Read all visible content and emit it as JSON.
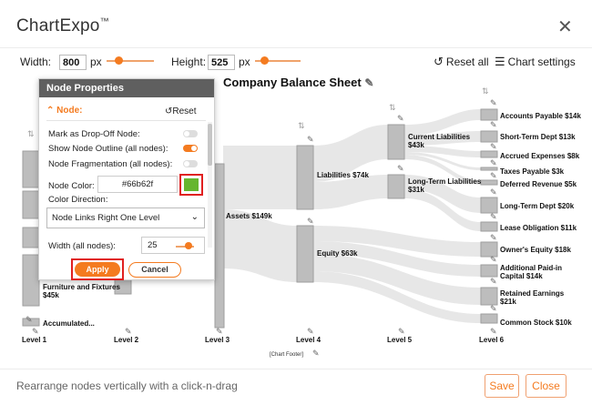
{
  "app": {
    "title": "ChartExpo",
    "trademark": "™"
  },
  "controls": {
    "width_label": "Width:",
    "width_value": "800",
    "width_unit": "px",
    "width_fraction": 0.25,
    "height_label": "Height:",
    "height_value": "525",
    "height_unit": "px",
    "height_fraction": 0.2,
    "reset_all": "Reset all",
    "chart_settings": "Chart settings"
  },
  "chart": {
    "title": "Company Balance Sheet",
    "nodes": {
      "furniture": "Furniture and Fixtures\n$45k",
      "accumulated": "Accumulated...",
      "assets": "Assets $149k",
      "liabilities": "Liabilities $74k",
      "equity": "Equity $63k",
      "current_liab": "Current Liabilities\n$43k",
      "longterm_liab": "Long-Term Liabilities\n$31k",
      "accounts_payable": "Accounts Payable $14k",
      "short_term_debt": "Short-Term Dept $13k",
      "accrued": "Accrued Expenses $8k",
      "taxes": "Taxes Payable $3k",
      "deferred": "Deferred Revenue $5k",
      "long_term_debt": "Long-Term Dept $20k",
      "lease": "Lease Obligation $11k",
      "owners_equity": "Owner's Equity $18k",
      "paid_in": "Additional Paid-in\nCapital $14k",
      "retained": "Retained Earnings\n$21k",
      "common_stock": "Common Stock $10k"
    },
    "levels": [
      "Level 1",
      "Level 2",
      "Level 3",
      "Level 4",
      "Level 5",
      "Level 6"
    ],
    "footer": "[Chart Footer]"
  },
  "panel": {
    "header": "Node Properties",
    "section": "Node:",
    "reset": "Reset",
    "mark_dropoff": "Mark as Drop-Off Node:",
    "mark_dropoff_on": false,
    "show_outline": "Show Node Outline (all nodes):",
    "show_outline_on": true,
    "fragmentation": "Node Fragmentation (all nodes):",
    "fragmentation_on": false,
    "node_color_label": "Node Color:",
    "node_color_value": "#66b62f",
    "color_direction_label": "Color Direction:",
    "color_direction_value": "Node Links Right One Level",
    "width_label": "Width (all nodes):",
    "width_value": "25",
    "apply": "Apply",
    "cancel": "Cancel"
  },
  "footer": {
    "hint": "Rearrange nodes vertically with a click-n-drag",
    "save": "Save",
    "close": "Close"
  },
  "colors": {
    "accent": "#f47b20",
    "node": "#bdbdbd",
    "link": "#e6e6e6",
    "swatch": "#66b62f",
    "highlight": "#e02020"
  }
}
